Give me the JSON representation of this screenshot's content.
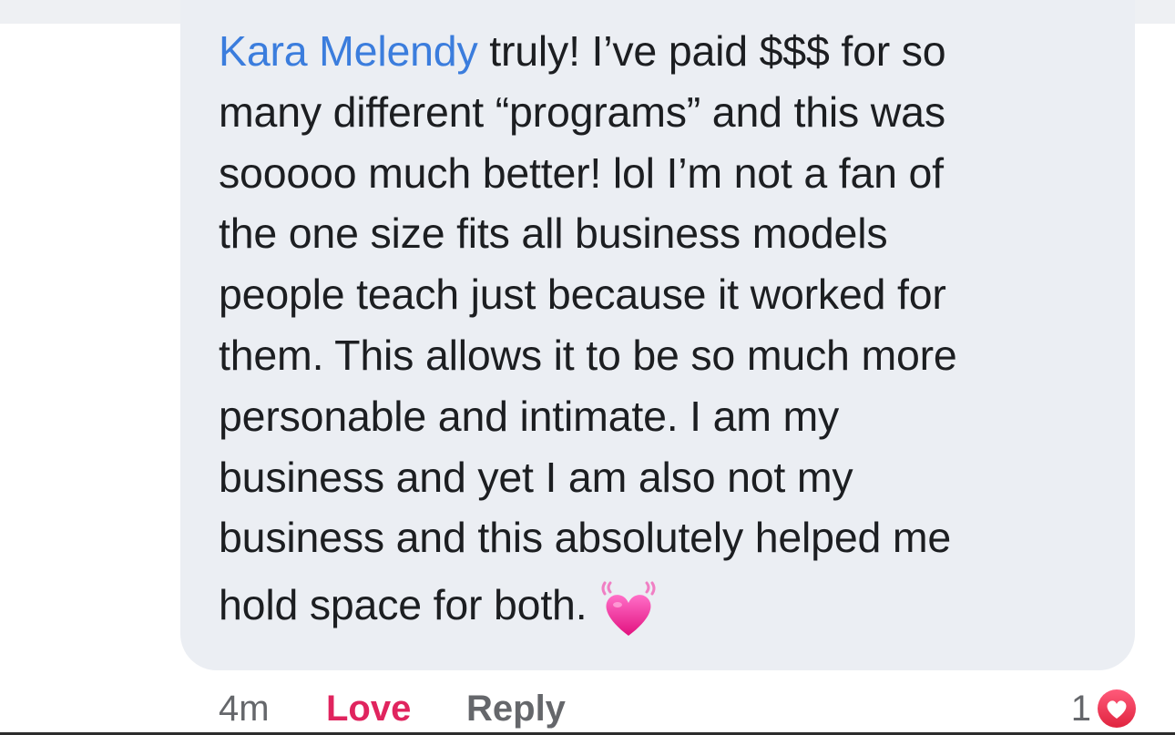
{
  "comment": {
    "author": "Kara Melendy",
    "lines": [
      "truly! I’ve paid $$$ for so",
      "many different “programs” and this was",
      "sooooo much better! lol I’m not a fan of",
      "the one size fits all business models",
      "people teach just because it worked for",
      "them. This allows it to be so much more",
      "personable and intimate. I am my",
      "business and yet I am also not my",
      "business and this absolutely helped me",
      "hold space for both."
    ],
    "emoji": "beating-heart-icon"
  },
  "footer": {
    "timestamp": "4m",
    "love_label": "Love",
    "reply_label": "Reply",
    "reaction_count": "1",
    "reaction_icon": "love-reaction-icon"
  },
  "colors": {
    "bubble": "#ebeef3",
    "author": "#3b7ddd",
    "love": "#e0245e",
    "meta": "#65676b"
  }
}
